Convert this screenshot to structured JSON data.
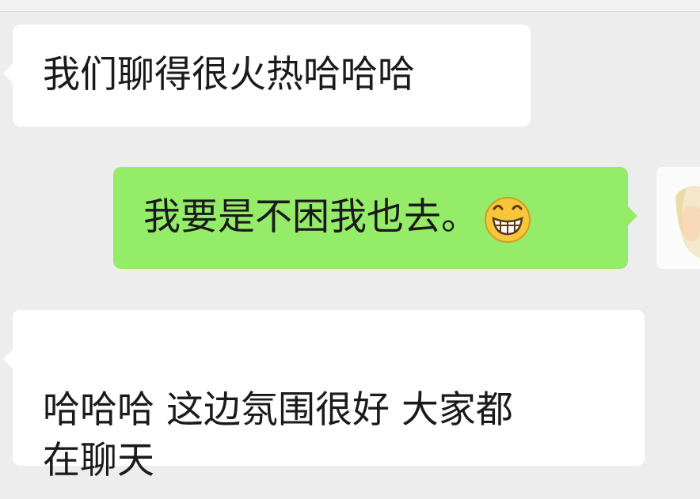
{
  "messages": [
    {
      "id": "msg1",
      "direction": "incoming",
      "text": "我们聊得很火热哈哈哈"
    },
    {
      "id": "msg2",
      "direction": "outgoing",
      "text": "我要是不困我也去。",
      "emoji": "grinning-face-icon"
    },
    {
      "id": "msg3",
      "direction": "incoming",
      "text": "哈哈哈 这边氛围很好 大家都\n在聊天"
    }
  ],
  "colors": {
    "background": "#ededed",
    "incoming_bubble": "#ffffff",
    "outgoing_bubble": "#95ec69",
    "text": "#1a1a1a"
  }
}
